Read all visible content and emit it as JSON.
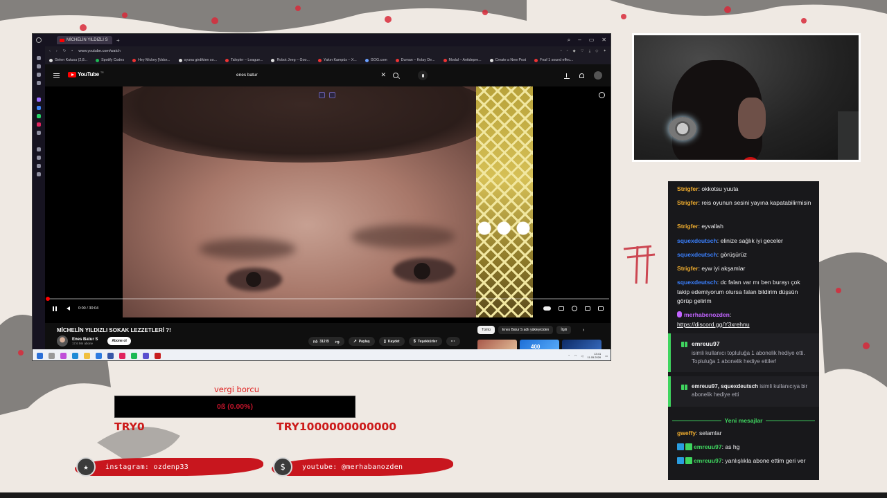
{
  "browser": {
    "tab_title": "MİCHELİN YILDIZLI S",
    "url": "www.youtube.com/watch",
    "bookmarks": [
      "Gelen Kutusu (2,8...",
      "Spotify Codes",
      "Hey Mickey [Valor...",
      "oyuna girdikten so...",
      "Talepler – League...",
      "Robot Jeeg – Goo...",
      "Yakın Kampüs – X...",
      "GOG.com",
      "Duman – Kolay De...",
      "Modal – Antidepre...",
      "Create a New Post",
      "Fnaf 1 sound effec..."
    ]
  },
  "youtube": {
    "logo": "YouTube",
    "logo_region": "TR",
    "search_query": "enes batur",
    "time": "0:00 / 30:04",
    "progress": 0.0,
    "video_title": "MİCHELİN YILDIZLI SOKAK LEZZETLERİ ?!",
    "channel_name": "Enes Batur S",
    "channel_subs": "17,6 Mn abone",
    "subscribe_label": "Abone ol",
    "likes": "312 B",
    "share_label": "Paylaş",
    "save_label": "Kaydet",
    "thanks_label": "Teşekkürler",
    "chips": [
      "Tümü",
      "Enes Batur S adlı yükleyiciden",
      "İlgili"
    ],
    "thumb_number": "400"
  },
  "taskbar": {
    "time": "13:41",
    "date": "11.05.2026"
  },
  "chat": {
    "messages": [
      {
        "user": "Strigfer",
        "text": ": okkotsu yuuta"
      },
      {
        "user": "Strigfer",
        "text": ": reis oyunun sesini yayına kapatabilirmisin"
      },
      {
        "user": "Strigfer",
        "text": ": eyvallah"
      },
      {
        "user": "squexdeutsch",
        "text": ": elinize sağlık iyi geceler"
      },
      {
        "user": "squexdeutsch",
        "text": ": görüşürüz"
      },
      {
        "user": "Strigfer",
        "text": ": eyw iyi akşamlar"
      },
      {
        "user": "squexdeutsch",
        "text": ": dc falan var mı ben burayı çok takip edemiyorum olursa falan bildirim düşsün görüp gelirim"
      },
      {
        "user": "merhabenozden",
        "text": ": ",
        "link": "https://discord.gg/Y3xrehnu"
      }
    ],
    "sub_gift": {
      "name": "emreuu97",
      "text_a": "isimli kullanıcı topluluğa 1 abonelik hediye etti.",
      "text_b": "Topluluğa 1 abonelik hediye ettiler!"
    },
    "sub_gift2": {
      "names": "emreuu97, squexdeutsch",
      "text": "isimli kullanıcıya bir abonelik hediye etti"
    },
    "new_messages_label": "Yeni mesajlar",
    "recent": [
      {
        "user": "gweffy",
        "text": ": selamlar"
      },
      {
        "user": "emreuu97",
        "text": ": as hg"
      },
      {
        "user": "emreuu97",
        "text": ": yanlışlıkla abone ettim geri ver"
      }
    ]
  },
  "goal": {
    "label": "vergi borcu",
    "value": "0ß (0.00%)",
    "min": "TRY0",
    "max": "TRY1000000000000"
  },
  "social": {
    "instagram": "instagram: ozdenp33",
    "youtube": "youtube: @merhabanozden"
  },
  "colors": {
    "accent_red": "#c8161e",
    "chat_bg": "#18181b",
    "sub_green": "#3fd55f"
  }
}
